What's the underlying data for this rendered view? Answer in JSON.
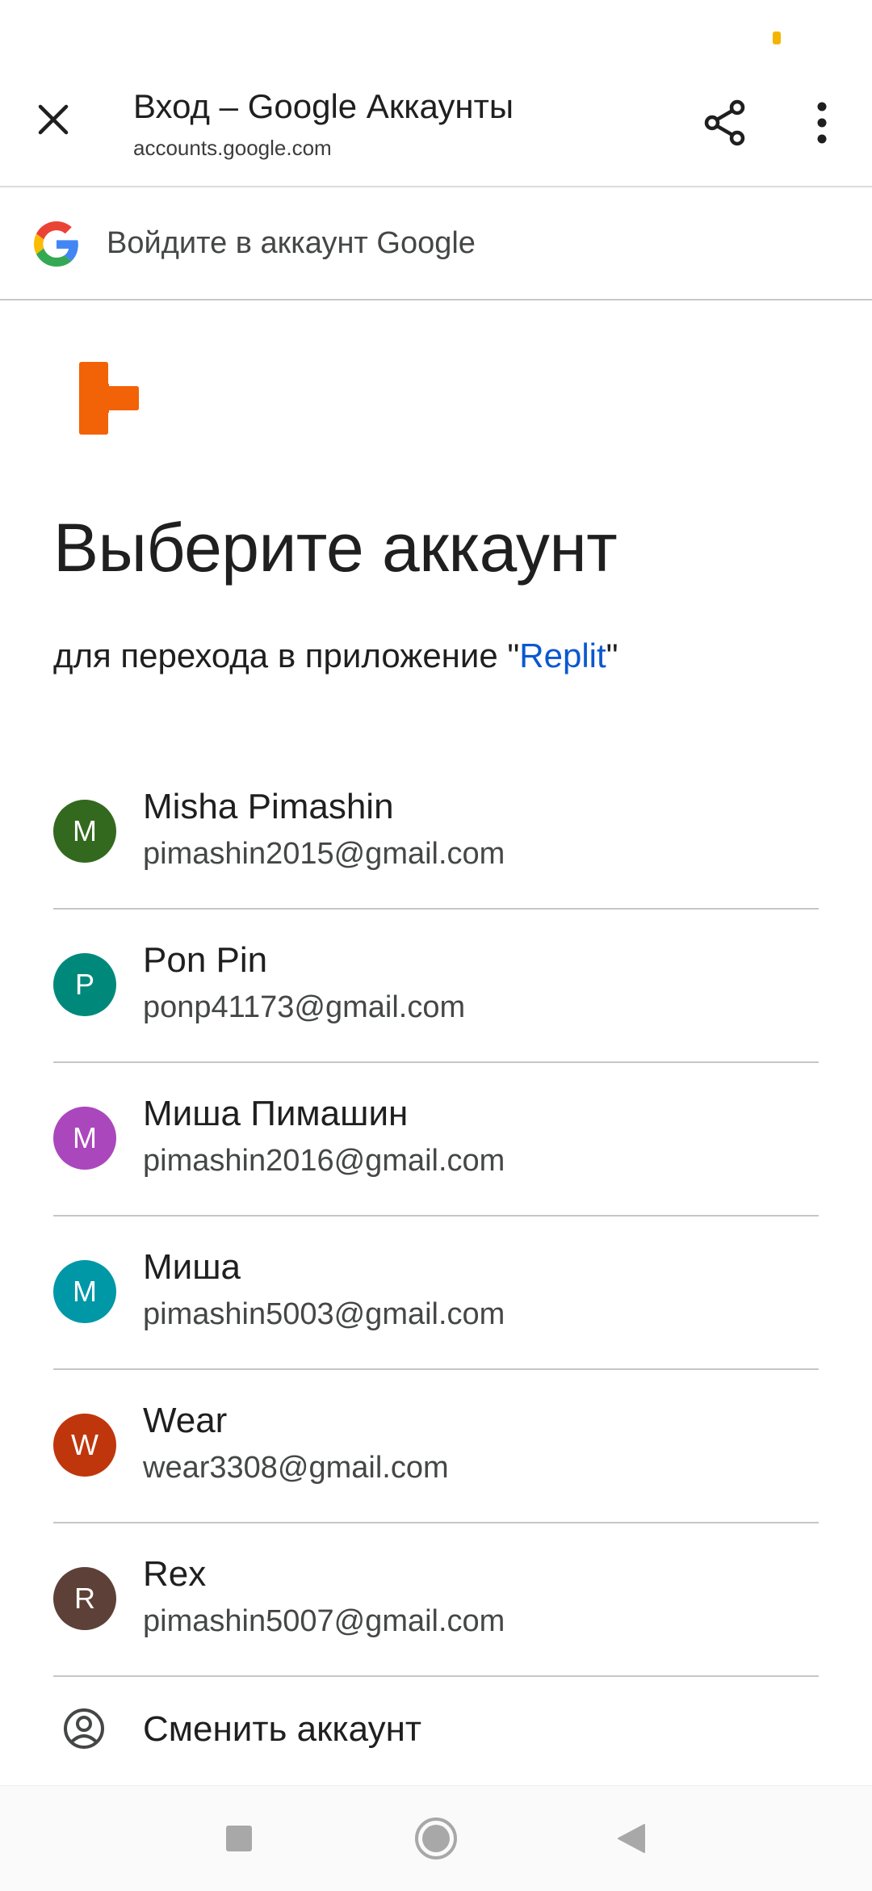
{
  "toolbar": {
    "title": "Вход – Google Аккаунты",
    "url": "accounts.google.com",
    "close_icon": "close-icon",
    "share_icon": "share-icon",
    "more_icon": "more-vert-icon"
  },
  "signin_bar": {
    "text": "Войдите в аккаунт Google",
    "icon": "google-g-logo"
  },
  "app": {
    "logo": "replit-logo",
    "brand_color": "#f26207"
  },
  "heading": "Выберите аккаунт",
  "subheading": {
    "prefix": "для перехода в приложение \"",
    "app_name": "Replit",
    "suffix": "\""
  },
  "accounts": [
    {
      "initial": "M",
      "name": "Misha Pimashin",
      "email": "pimashin2015@gmail.com",
      "color": "#33691e"
    },
    {
      "initial": "P",
      "name": "Pon Pin",
      "email": "ponp41173@gmail.com",
      "color": "#00897b"
    },
    {
      "initial": "M",
      "name": "Миша Пимашин",
      "email": "pimashin2016@gmail.com",
      "color": "#ab47bc"
    },
    {
      "initial": "M",
      "name": "Миша",
      "email": "pimashin5003@gmail.com",
      "color": "#0097a7"
    },
    {
      "initial": "W",
      "name": "Wear",
      "email": "wear3308@gmail.com",
      "color": "#bf360c"
    },
    {
      "initial": "R",
      "name": "Rex",
      "email": "pimashin5007@gmail.com",
      "color": "#5d4037"
    }
  ],
  "switch_account": {
    "label": "Сменить аккаунт",
    "icon": "account-circle-icon"
  },
  "navbar": {
    "recents_icon": "square-recents-icon",
    "home_icon": "circle-home-icon",
    "back_icon": "triangle-back-icon"
  }
}
